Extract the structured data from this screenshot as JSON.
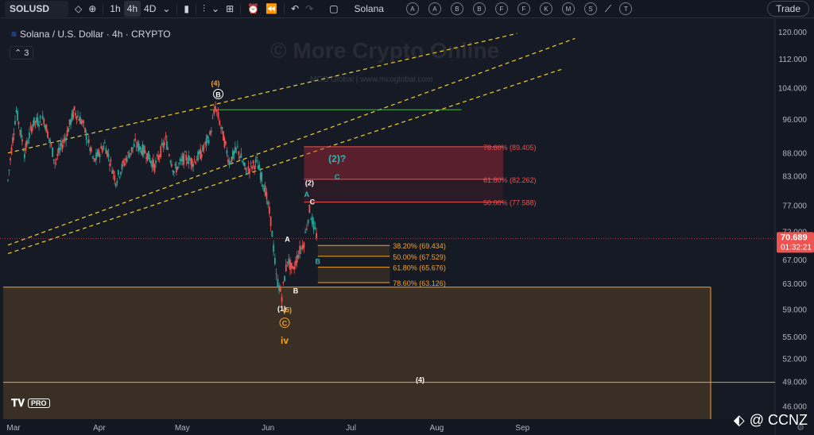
{
  "toolbar": {
    "symbol": "SOLUSD",
    "timeframes": [
      "1h",
      "4h",
      "4D"
    ],
    "active_timeframe": "4h",
    "search_label": "Solana",
    "letter_buttons": [
      "A",
      "A",
      "B",
      "B",
      "F",
      "F",
      "K",
      "M",
      "S",
      "T"
    ],
    "trade_label": "Trade"
  },
  "legend": {
    "title": "Solana / U.S. Dollar · 4h · CRYPTO",
    "indicator_count": "3"
  },
  "watermark": {
    "main": "© More Crypto Online",
    "sub": "MCO Global  |  www.mcoglobal.com"
  },
  "branding": {
    "tv_pro": "PRO",
    "ccnz": "@ CCNZ"
  },
  "colors": {
    "up": "#26a69a",
    "down": "#ef5350",
    "orange": "#f7a325",
    "red_fib": "#f05050",
    "green_line": "#4caf50",
    "yellow_dash": "#f2d024",
    "teal_label": "#2bb8b0"
  },
  "chart_data": {
    "type": "candlestick",
    "title": "Solana / U.S. Dollar · 4h · CRYPTO",
    "x_ticks": [
      "Mar",
      "Apr",
      "May",
      "Jun",
      "Jul",
      "Aug",
      "Sep"
    ],
    "y_ticks": [
      120.0,
      112.0,
      104.0,
      96.0,
      88.0,
      83.0,
      77.0,
      72.0,
      67.0,
      63.0,
      59.0,
      55.0,
      52.0,
      49.0,
      46.0
    ],
    "y_scale": "log",
    "ylim": [
      44.5,
      124
    ],
    "current_price": "70.689",
    "countdown": "01:32:21",
    "path_points": [
      [
        "2024-02-28",
        82
      ],
      [
        "2024-03-02",
        98
      ],
      [
        "2024-03-05",
        88
      ],
      [
        "2024-03-08",
        95
      ],
      [
        "2024-03-12",
        96
      ],
      [
        "2024-03-16",
        86
      ],
      [
        "2024-03-20",
        92
      ],
      [
        "2024-03-23",
        98
      ],
      [
        "2024-03-26",
        95
      ],
      [
        "2024-03-30",
        86
      ],
      [
        "2024-04-03",
        90
      ],
      [
        "2024-04-07",
        82
      ],
      [
        "2024-04-11",
        87
      ],
      [
        "2024-04-14",
        90
      ],
      [
        "2024-04-18",
        88
      ],
      [
        "2024-04-21",
        85
      ],
      [
        "2024-04-25",
        91
      ],
      [
        "2024-04-28",
        84
      ],
      [
        "2024-05-02",
        87
      ],
      [
        "2024-05-05",
        86
      ],
      [
        "2024-05-08",
        88
      ],
      [
        "2024-05-11",
        92
      ],
      [
        "2024-05-13",
        99
      ],
      [
        "2024-05-15",
        94
      ],
      [
        "2024-05-18",
        86
      ],
      [
        "2024-05-21",
        89
      ],
      [
        "2024-05-24",
        84
      ],
      [
        "2024-05-28",
        86
      ],
      [
        "2024-05-31",
        80
      ],
      [
        "2024-06-02",
        74
      ],
      [
        "2024-06-04",
        64
      ],
      [
        "2024-06-06",
        61
      ],
      [
        "2024-06-08",
        67
      ],
      [
        "2024-06-10",
        65
      ],
      [
        "2024-06-12",
        68
      ],
      [
        "2024-06-14",
        70
      ],
      [
        "2024-06-16",
        76
      ],
      [
        "2024-06-18",
        72
      ],
      [
        "2024-06-19",
        70.7
      ]
    ],
    "fib_levels_upper": [
      {
        "label": "78.60% (89.405)",
        "value": 89.405
      },
      {
        "label": "61.80% (82.262)",
        "value": 82.262
      },
      {
        "label": "50.00% (77.588)",
        "value": 77.588
      }
    ],
    "fib_levels_lower": [
      {
        "label": "38.20% (69.434)",
        "value": 69.434
      },
      {
        "label": "50.00% (67.529)",
        "value": 67.529
      },
      {
        "label": "61.80% (65.676)",
        "value": 65.676
      },
      {
        "label": "78.60% (63.126)",
        "value": 63.126
      }
    ],
    "horizontal_lines": [
      {
        "name": "green-resistance",
        "value": 98.3
      },
      {
        "name": "orange-support-top",
        "value": 62.4
      },
      {
        "name": "orange-support-bottom",
        "value": 48.9
      }
    ],
    "wave_labels": [
      {
        "text": "(4)",
        "color": "orange",
        "date": "2024-05-13",
        "price": 104.5
      },
      {
        "text": "B",
        "color": "white",
        "circled": true,
        "date": "2024-05-14",
        "price": 101.5
      },
      {
        "text": "(2)?",
        "color": "teal",
        "date": "2024-06-26",
        "price": 86
      },
      {
        "text": "C",
        "color": "teal",
        "date": "2024-06-26",
        "price": 82.2
      },
      {
        "text": "(2)",
        "color": "white",
        "date": "2024-06-16",
        "price": 81
      },
      {
        "text": "A",
        "color": "teal",
        "date": "2024-06-15",
        "price": 78.6
      },
      {
        "text": "C",
        "color": "white",
        "date": "2024-06-17",
        "price": 77.1
      },
      {
        "text": "A",
        "color": "white",
        "date": "2024-06-08",
        "price": 70.1
      },
      {
        "text": "B",
        "color": "teal",
        "date": "2024-06-19",
        "price": 66.2
      },
      {
        "text": "B",
        "color": "white",
        "date": "2024-06-11",
        "price": 61.4
      },
      {
        "text": "(1)",
        "color": "white",
        "date": "2024-06-06",
        "price": 58.7
      },
      {
        "text": "(5)",
        "color": "orange",
        "date": "2024-06-08",
        "price": 58.5
      },
      {
        "text": "C",
        "color": "orange",
        "circled": true,
        "date": "2024-06-07",
        "price": 56.5
      },
      {
        "text": "iv",
        "color": "orange",
        "date": "2024-06-07",
        "price": 54.0
      },
      {
        "text": "(4)",
        "color": "white",
        "date": "2024-07-26",
        "price": 48.9
      }
    ]
  }
}
